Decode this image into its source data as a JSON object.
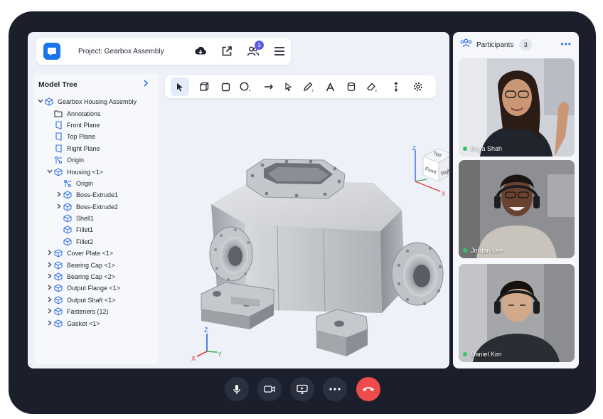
{
  "header": {
    "project_title": "Project: Gearbox Assembly",
    "participants_badge": "3"
  },
  "model_tree": {
    "title": "Model Tree",
    "items": [
      {
        "label": "Gearbox Housing Assembly",
        "icon": "assembly-icon",
        "indent": 0,
        "arrow": "down"
      },
      {
        "label": "Annotations",
        "icon": "folder-icon",
        "indent": 1,
        "arrow": ""
      },
      {
        "label": "Front Plane",
        "icon": "plane-icon",
        "indent": 1,
        "arrow": ""
      },
      {
        "label": "Top Plane",
        "icon": "plane-icon",
        "indent": 1,
        "arrow": ""
      },
      {
        "label": "Right Plane",
        "icon": "plane-icon",
        "indent": 1,
        "arrow": ""
      },
      {
        "label": "Origin",
        "icon": "origin-icon",
        "indent": 1,
        "arrow": ""
      },
      {
        "label": "Housing <1>",
        "icon": "part-icon",
        "indent": 1,
        "arrow": "down"
      },
      {
        "label": "Origin",
        "icon": "origin-icon",
        "indent": 2,
        "arrow": ""
      },
      {
        "label": "Boss-Extrude1",
        "icon": "part-icon",
        "indent": 2,
        "arrow": "right"
      },
      {
        "label": "Boss-Extrude2",
        "icon": "part-icon",
        "indent": 2,
        "arrow": "right"
      },
      {
        "label": "Shell1",
        "icon": "part-icon",
        "indent": 2,
        "arrow": ""
      },
      {
        "label": "Fillet1",
        "icon": "part-icon",
        "indent": 2,
        "arrow": ""
      },
      {
        "label": "Fillet2",
        "icon": "part-icon",
        "indent": 2,
        "arrow": ""
      },
      {
        "label": "Cover Plate <1>",
        "icon": "part-icon",
        "indent": 1,
        "arrow": "right"
      },
      {
        "label": "Bearing Cap <1>",
        "icon": "part-icon",
        "indent": 1,
        "arrow": "right"
      },
      {
        "label": "Bearing Cap <2>",
        "icon": "part-icon",
        "indent": 1,
        "arrow": "right"
      },
      {
        "label": "Output Flange <1>",
        "icon": "part-icon",
        "indent": 1,
        "arrow": "right"
      },
      {
        "label": "Output Shaft <1>",
        "icon": "part-icon",
        "indent": 1,
        "arrow": "right"
      },
      {
        "label": "Fasteners (12)",
        "icon": "part-icon",
        "indent": 1,
        "arrow": "right"
      },
      {
        "label": "Gasket <1>",
        "icon": "part-icon",
        "indent": 1,
        "arrow": "right"
      }
    ]
  },
  "toolbar": {
    "tools": [
      "select-tool",
      "box-tool",
      "rectangle-tool",
      "circle-tool",
      "line-tool",
      "pointer-tool",
      "pencil-tool",
      "text-tool",
      "cylinder-tool",
      "eraser-tool",
      "rotate-tool",
      "settings-tool"
    ]
  },
  "viewport": {
    "view_cube": {
      "top": "Top",
      "front": "Front",
      "right": "Right"
    },
    "axes": {
      "x": "X",
      "y": "Y",
      "z": "Z"
    }
  },
  "participants": {
    "title": "Participants",
    "count": "3",
    "people": [
      {
        "name": "Priya Shah",
        "status": "online"
      },
      {
        "name": "Jordan Lee",
        "status": "online"
      },
      {
        "name": "Daniel Kim",
        "status": "online"
      }
    ]
  },
  "call_controls": [
    "microphone",
    "camera",
    "screen-share",
    "more",
    "end-call"
  ],
  "colors": {
    "accent": "#1a73e8",
    "end_call": "#ee4b4b",
    "online": "#35c46a",
    "device": "#1b1f2b"
  }
}
